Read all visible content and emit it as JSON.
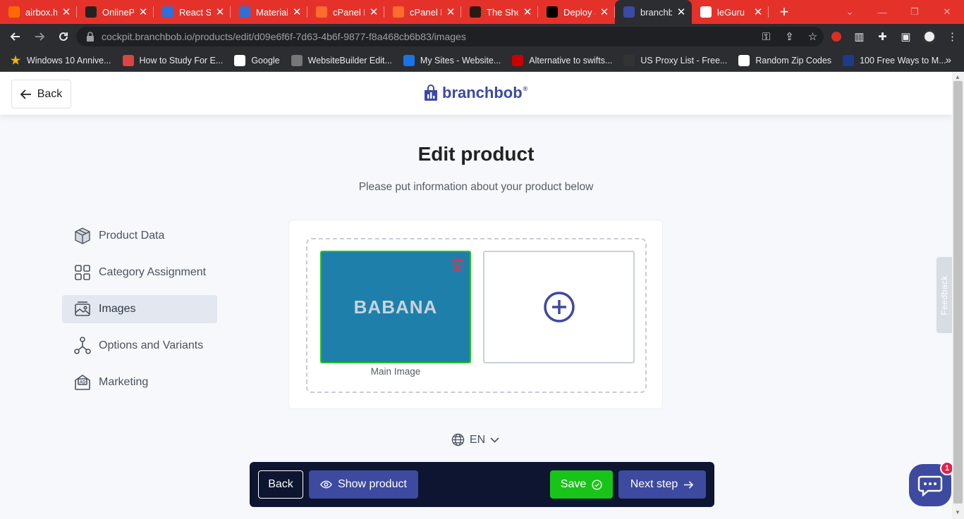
{
  "browser": {
    "tabs": [
      {
        "title": "airbox.ho",
        "icon": "airbox-icon",
        "color": "#ff6a00"
      },
      {
        "title": "OnlinePay",
        "icon": "react-icon",
        "color": "#222"
      },
      {
        "title": "React Sel",
        "icon": "material-ui-icon",
        "color": "#2f6fd6"
      },
      {
        "title": "Material",
        "icon": "material-ui-icon",
        "color": "#2f6fd6"
      },
      {
        "title": "cPanel Fi",
        "icon": "cpanel-icon",
        "color": "#ff6c2c"
      },
      {
        "title": "cPanel Fi",
        "icon": "cpanel-icon",
        "color": "#ff6c2c"
      },
      {
        "title": "The Shop",
        "icon": "shop-icon",
        "color": "#2a1a12"
      },
      {
        "title": "Deploy a",
        "icon": "dev-icon",
        "color": "#000"
      },
      {
        "title": "branchbo",
        "icon": "branchbob-icon",
        "color": "#3a4aa5",
        "active": true
      },
      {
        "title": "leGuru",
        "icon": "globe-icon",
        "color": "#ffffff"
      }
    ],
    "url_host": "cockpit.branchbob.io",
    "url_path": "/products/edit/d09e6f6f-7d63-4b6f-9877-f8a468cb6b83/images",
    "bookmarks": [
      {
        "label": "Windows 10 Annive...",
        "icon": "star-icon",
        "color": "#f4b400"
      },
      {
        "label": "How to Study For E...",
        "icon": "bookmark-icon",
        "color": "#d44"
      },
      {
        "label": "Google",
        "icon": "google-icon",
        "color": "#fff"
      },
      {
        "label": "WebsiteBuilder Edit...",
        "icon": "globe-icon",
        "color": "#777"
      },
      {
        "label": "My Sites - Website...",
        "icon": "gear-icon",
        "color": "#1a73e8"
      },
      {
        "label": "Alternative to swifts...",
        "icon": "bookmark-icon",
        "color": "#c00"
      },
      {
        "label": "US Proxy List - Free...",
        "icon": "proxy-icon",
        "color": "#333"
      },
      {
        "label": "Random Zip Codes",
        "icon": "dice-icon",
        "color": "#fff"
      },
      {
        "label": "100 Free Ways to M...",
        "icon": "mp-icon",
        "color": "#1e3a8a"
      }
    ]
  },
  "header": {
    "back_label": "Back",
    "logo_text": "branchbob",
    "logo_mark": "®"
  },
  "main": {
    "title": "Edit product",
    "subtitle": "Please put information about your product below"
  },
  "sidenav": {
    "items": [
      {
        "label": "Product Data",
        "icon": "box-icon"
      },
      {
        "label": "Category Assignment",
        "icon": "grid-icon"
      },
      {
        "label": "Images",
        "icon": "image-icon",
        "active": true
      },
      {
        "label": "Options and Variants",
        "icon": "variants-icon"
      },
      {
        "label": "Marketing",
        "icon": "ad-icon"
      }
    ]
  },
  "images": {
    "main_image_text": "BABANA",
    "main_caption": "Main Image"
  },
  "language": {
    "code": "EN"
  },
  "actions": {
    "back": "Back",
    "show_product": "Show product",
    "save": "Save",
    "next_step": "Next step"
  },
  "feedback": {
    "label": "Feedback"
  },
  "chat": {
    "badge": "1"
  },
  "colors": {
    "tabstrip": "#e4322b",
    "brand": "#3d4aa0",
    "save": "#19c419",
    "action_bar": "#0d1530",
    "image_bg": "#1f7fab"
  }
}
